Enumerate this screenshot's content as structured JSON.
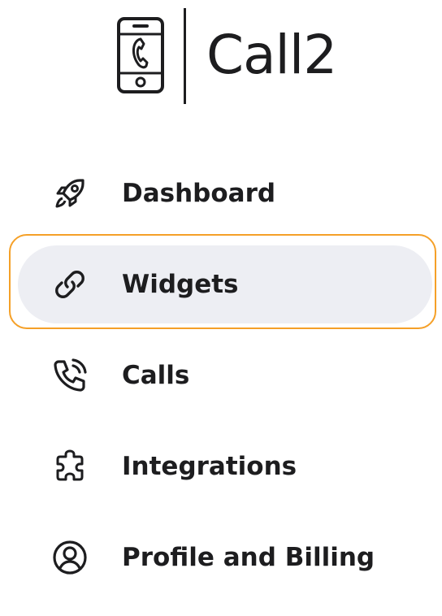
{
  "brand": {
    "name": "Call2",
    "logo_icon": "phone-icon"
  },
  "colors": {
    "active_bg": "#edeef3",
    "focus_ring": "#f5a028",
    "text": "#1d1d1f"
  },
  "nav": {
    "items": [
      {
        "label": "Dashboard",
        "icon": "rocket-icon",
        "active": false
      },
      {
        "label": "Widgets",
        "icon": "link-icon",
        "active": true
      },
      {
        "label": "Calls",
        "icon": "phone-call-icon",
        "active": false
      },
      {
        "label": "Integrations",
        "icon": "puzzle-icon",
        "active": false
      },
      {
        "label": "Profile and Billing",
        "icon": "user-circle-icon",
        "active": false
      }
    ]
  }
}
